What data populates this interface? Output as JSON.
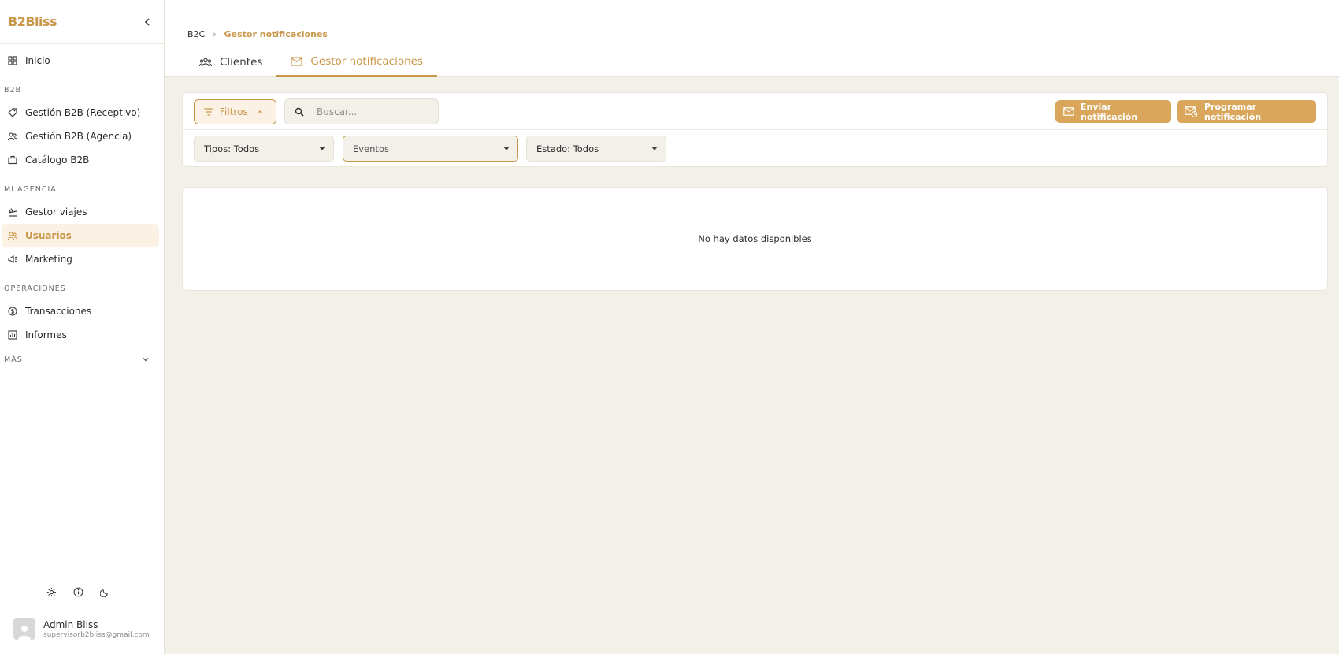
{
  "app": {
    "logo": "B2Bliss"
  },
  "sidebar": {
    "top_items": [
      {
        "label": "Inicio",
        "icon": "grid-icon"
      }
    ],
    "sections": [
      {
        "title": "B2B",
        "items": [
          {
            "label": "Gestión B2B (Receptivo)",
            "icon": "tag-icon"
          },
          {
            "label": "Gestión B2B (Agencia)",
            "icon": "users-icon"
          },
          {
            "label": "Catálogo B2B",
            "icon": "briefcase-icon"
          }
        ]
      },
      {
        "title": "MI AGENCIA",
        "items": [
          {
            "label": "Gestor viajes",
            "icon": "plane-icon"
          },
          {
            "label": "Usuarios",
            "icon": "users-icon",
            "active": true
          },
          {
            "label": "Marketing",
            "icon": "megaphone-icon"
          }
        ]
      },
      {
        "title": "OPERACIONES",
        "items": [
          {
            "label": "Transacciones",
            "icon": "dollar-icon"
          },
          {
            "label": "Informes",
            "icon": "chart-icon"
          }
        ]
      }
    ],
    "more_label": "MÁS",
    "bottom_icons": [
      "gear-icon",
      "info-icon",
      "moon-icon"
    ],
    "user": {
      "name": "Admin Bliss",
      "email": "supervisorb2bliss@gmail.com"
    }
  },
  "header": {
    "breadcrumb": [
      "B2C",
      "Gestor notificaciones"
    ],
    "tabs": [
      {
        "label": "Clientes",
        "icon": "group-icon",
        "active": false
      },
      {
        "label": "Gestor notificaciones",
        "icon": "mail-icon",
        "active": true
      }
    ]
  },
  "toolbar": {
    "filters_label": "Filtros",
    "search_placeholder": "Buscar...",
    "send_label": "Enviar notificación",
    "schedule_label": "Programar notificación"
  },
  "filters": {
    "tipos": "Tipos: Todos",
    "eventos": "Eventos",
    "estado": "Estado: Todos"
  },
  "table": {
    "empty_message": "No hay datos disponibles"
  },
  "colors": {
    "accent": "#c9974a",
    "button": "#d9a65b",
    "background": "#f3f0ea"
  }
}
